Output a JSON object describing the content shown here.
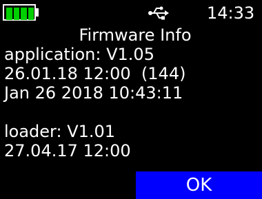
{
  "status_bar": {
    "battery_icon": "battery-full-icon",
    "battery_color": "#00d000",
    "usb_icon": "usb-icon",
    "time": "14:33"
  },
  "title": "Firmware Info",
  "application": {
    "version_line": "application: V1.05",
    "date_line": "26.01.18 12:00  (144)",
    "build_line": "Jan 26 2018 10:43:11"
  },
  "loader": {
    "version_line": "loader: V1.01",
    "date_line": "27.04.17 12:00"
  },
  "ok_button": {
    "label": "OK",
    "color": "#0000ff"
  }
}
